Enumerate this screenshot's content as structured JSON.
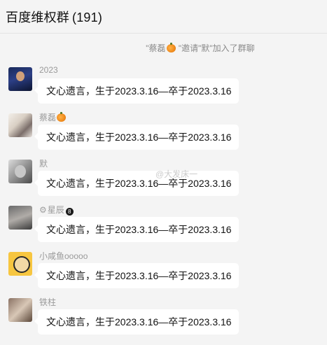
{
  "header": {
    "title": "百度维权群",
    "count": "(191)"
  },
  "system": {
    "prefix": "\"蔡磊",
    "middle": " \"邀请\"默\"加入了群聊"
  },
  "messages": [
    {
      "sender": "2023",
      "text": "文心遗言，生于2023.3.16—卒于2023.3.16",
      "avatar": "avatar-1"
    },
    {
      "sender": "蔡磊",
      "text": "文心遗言，生于2023.3.16—卒于2023.3.16",
      "avatar": "avatar-2"
    },
    {
      "sender": "默",
      "text": "文心遗言，生于2023.3.16—卒于2023.3.16",
      "avatar": "avatar-3"
    },
    {
      "sender": "星辰",
      "text": "文心遗言，生于2023.3.16—卒于2023.3.16",
      "avatar": "avatar-4"
    },
    {
      "sender": "小咸鱼ooooo",
      "text": "文心遗言，生于2023.3.16—卒于2023.3.16",
      "avatar": "avatar-5"
    },
    {
      "sender": "铁柱",
      "text": "文心遗言，生于2023.3.16—卒于2023.3.16",
      "avatar": "avatar-6"
    }
  ],
  "watermark": "@大发床一",
  "icons": {
    "pumpkin": "pumpkin-emoji-icon",
    "gear": "gear-icon",
    "badge": "number-8-badge-icon"
  },
  "colors": {
    "background": "#f4f4f4",
    "bubble": "#ffffff",
    "muted": "#9a9a9a"
  }
}
